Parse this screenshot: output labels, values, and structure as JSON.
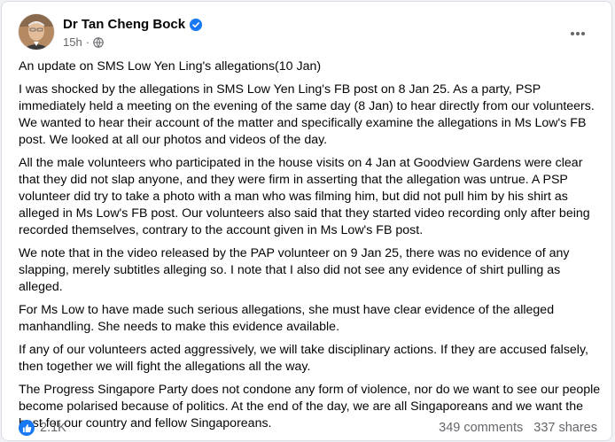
{
  "post": {
    "author": "Dr Tan Cheng Bock",
    "time": "15h",
    "separator": "·",
    "paragraphs": [
      "An update on SMS Low Yen Ling's  allegations(10 Jan)",
      "I was shocked by the allegations in SMS Low Yen Ling's FB post on 8 Jan 25.  As a party, PSP immediately held a meeting on the evening of the same day (8 Jan) to hear directly from our volunteers. We wanted to hear their account of the matter and specifically examine the allegations in Ms Low's FB post. We looked at all our photos and videos of the day.",
      "All the male volunteers who participated in the house visits on 4 Jan at Goodview Gardens were clear that they did not slap anyone, and they were firm in asserting that the allegation was untrue.  A PSP volunteer did try to take a photo with a man who was filming him, but did not pull him by his shirt as alleged in Ms Low's FB post.   Our volunteers also said that they started video recording only after being recorded themselves, contrary to the account given in Ms Low's FB post.",
      "We note that in the video released by the PAP volunteer on 9 Jan 25, there was no evidence of any slapping, merely subtitles alleging so. I note that I also did not see any evidence of shirt pulling as alleged.",
      "For Ms Low to have made such serious allegations, she must have clear evidence of the alleged manhandling.  She needs to make this evidence available.",
      "If any of our volunteers acted aggressively, we will take disciplinary actions.  If they are accused falsely, then together we will fight the allegations all the way.",
      "The Progress Singapore Party does not condone any form of violence, nor do we want to see our people become polarised because of politics. At the end of the day, we are all Singaporeans and we want the best for our country and fellow Singaporeans."
    ],
    "reactions": "2.1K",
    "comments": "349 comments",
    "shares": "337 shares"
  },
  "icons": {
    "verified": "verified-badge-icon",
    "privacy": "globe-icon",
    "more": "more-options-icon",
    "like": "like-icon"
  },
  "colors": {
    "accent": "#1877f2",
    "secondary_text": "#65676b",
    "card_bg": "#ffffff",
    "page_bg": "#f0f2f5"
  }
}
